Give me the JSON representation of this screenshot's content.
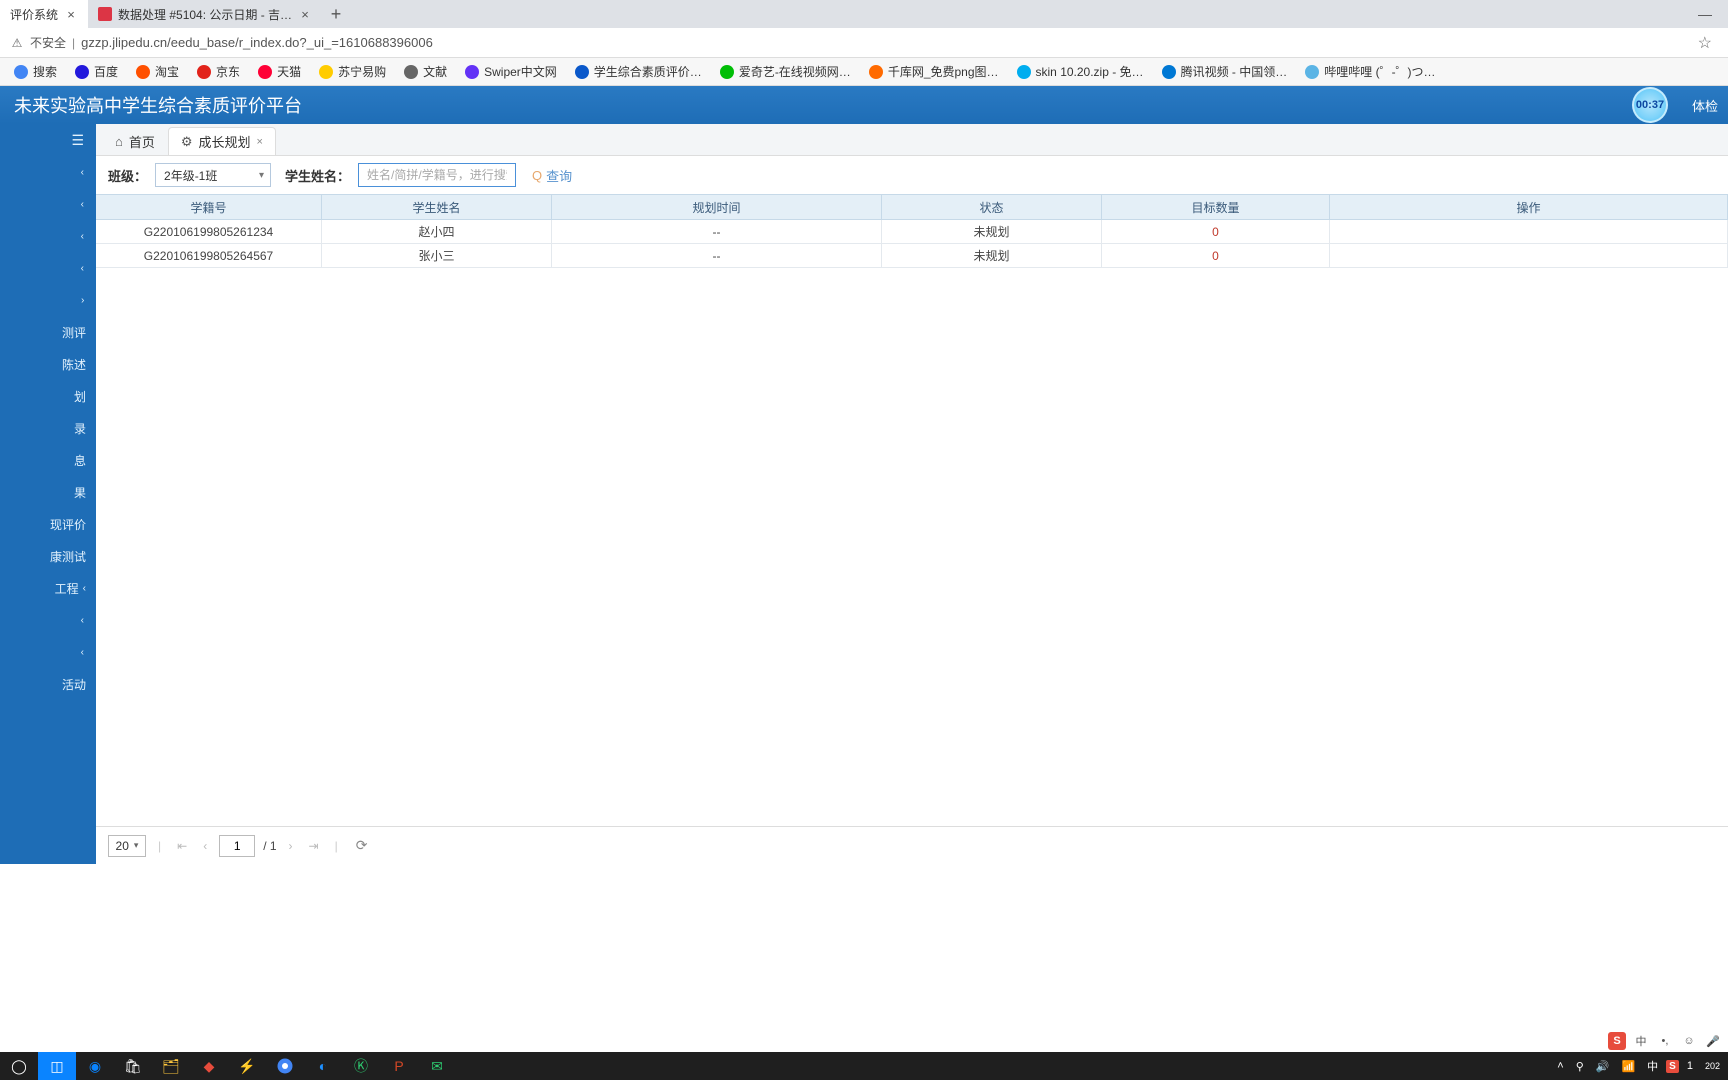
{
  "browser": {
    "tabs": [
      {
        "title": "评价系统",
        "active": true
      },
      {
        "title": "数据处理 #5104: 公示日期 - 吉…",
        "active": false
      }
    ],
    "security_label": "不安全",
    "url": "gzzp.jlipedu.cn/eedu_base/r_index.do?_ui_=1610688396006"
  },
  "bookmarks": [
    {
      "label": "搜索"
    },
    {
      "label": "百度"
    },
    {
      "label": "淘宝"
    },
    {
      "label": "京东"
    },
    {
      "label": "天猫"
    },
    {
      "label": "苏宁易购"
    },
    {
      "label": "文献"
    },
    {
      "label": "Swiper中文网"
    },
    {
      "label": "学生综合素质评价…"
    },
    {
      "label": "爱奇艺-在线视频网…"
    },
    {
      "label": "千库网_免费png图…"
    },
    {
      "label": "skin 10.20.zip - 免…"
    },
    {
      "label": "腾讯视频 - 中国领…"
    },
    {
      "label": "哔哩哔哩 (゜-゜)つ…"
    }
  ],
  "app": {
    "title": "未来实验高中学生综合素质评价平台",
    "recording_time": "00:37",
    "header_right": "体检"
  },
  "sidebar": {
    "items": [
      {
        "label": "测评"
      },
      {
        "label": "陈述"
      },
      {
        "label": "划"
      },
      {
        "label": "录"
      },
      {
        "label": "息"
      },
      {
        "label": "果"
      },
      {
        "label": "现评价"
      },
      {
        "label": "康测试"
      },
      {
        "label": "工程"
      },
      {
        "label": "活动"
      }
    ]
  },
  "content_tabs": {
    "home": "首页",
    "active": "成长规划"
  },
  "filter": {
    "class_label": "班级：",
    "class_value": "2年级-1班",
    "name_label": "学生姓名：",
    "name_placeholder": "姓名/简拼/学籍号，进行搜索",
    "query_label": "查询"
  },
  "table": {
    "headers": {
      "id": "学籍号",
      "name": "学生姓名",
      "time": "规划时间",
      "status": "状态",
      "count": "目标数量",
      "op": "操作"
    },
    "rows": [
      {
        "id": "G220106199805261234",
        "name": "赵小四",
        "time": "--",
        "status": "未规划",
        "count": "0"
      },
      {
        "id": "G220106199805264567",
        "name": "张小三",
        "time": "--",
        "status": "未规划",
        "count": "0"
      }
    ]
  },
  "pagination": {
    "page_size": "20",
    "page": "1",
    "total_pages": "/ 1"
  },
  "ime": {
    "mode": "中"
  },
  "tray": {
    "lang": "中",
    "time": "1",
    "date": "202"
  }
}
